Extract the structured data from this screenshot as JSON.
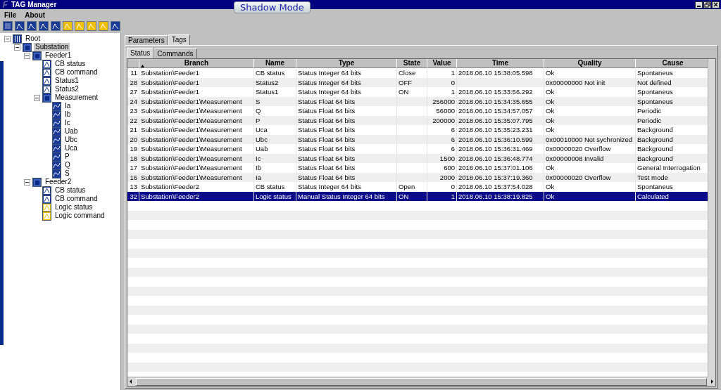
{
  "window": {
    "title": "TAG Manager",
    "mode_button": "Shadow Mode"
  },
  "menu": [
    "File",
    "About"
  ],
  "tree": [
    {
      "label": "Root",
      "kind": "root",
      "expanded": true,
      "selected": false,
      "children": [
        {
          "label": "Substation",
          "kind": "folder",
          "expanded": true,
          "selected": true,
          "children": [
            {
              "label": "Feeder1",
              "kind": "folder",
              "expanded": true,
              "selected": false,
              "children": [
                {
                  "label": "CB status",
                  "kind": "status",
                  "selected": false
                },
                {
                  "label": "CB command",
                  "kind": "command",
                  "selected": false
                },
                {
                  "label": "Status1",
                  "kind": "status",
                  "selected": false
                },
                {
                  "label": "Status2",
                  "kind": "status",
                  "selected": false
                },
                {
                  "label": "Measurement",
                  "kind": "folder",
                  "expanded": true,
                  "selected": false,
                  "children": [
                    {
                      "label": "Ia",
                      "kind": "measure",
                      "selected": false
                    },
                    {
                      "label": "Ib",
                      "kind": "measure",
                      "selected": false
                    },
                    {
                      "label": "Ic",
                      "kind": "measure",
                      "selected": false
                    },
                    {
                      "label": "Uab",
                      "kind": "measure",
                      "selected": false
                    },
                    {
                      "label": "Ubc",
                      "kind": "measure",
                      "selected": false
                    },
                    {
                      "label": "Uca",
                      "kind": "measure",
                      "selected": false
                    },
                    {
                      "label": "P",
                      "kind": "measure",
                      "selected": false
                    },
                    {
                      "label": "Q",
                      "kind": "measure",
                      "selected": false
                    },
                    {
                      "label": "S",
                      "kind": "measure",
                      "selected": false
                    }
                  ]
                }
              ]
            },
            {
              "label": "Feeder2",
              "kind": "folder",
              "expanded": true,
              "selected": false,
              "children": [
                {
                  "label": "CB status",
                  "kind": "status",
                  "selected": false
                },
                {
                  "label": "CB command",
                  "kind": "command",
                  "selected": false
                },
                {
                  "label": "Logic status",
                  "kind": "logic",
                  "selected": false
                },
                {
                  "label": "Logic command",
                  "kind": "logic",
                  "selected": false
                }
              ]
            }
          ]
        }
      ]
    }
  ],
  "tabs": [
    {
      "label": "Parameters",
      "selected": false
    },
    {
      "label": "Tags",
      "selected": true
    }
  ],
  "subtabs": [
    {
      "label": "Status",
      "selected": true
    },
    {
      "label": "Commands",
      "selected": false
    }
  ],
  "table": {
    "columns": [
      "Branch",
      "Name",
      "Type",
      "State",
      "Value",
      "Time",
      "Quality",
      "Cause"
    ],
    "rows": [
      {
        "id": "11",
        "cells": [
          "Substation\\Feeder1",
          "CB status",
          "Status Integer 64 bits",
          "Close",
          "1",
          "2018.06.10 15:38:05.598",
          "Ok",
          "Spontaneus"
        ],
        "selected": false
      },
      {
        "id": "28",
        "cells": [
          "Substation\\Feeder1",
          "Status2",
          "Status Integer 64 bits",
          "OFF",
          "0",
          "",
          "0x00000000 Not init",
          "Not defined"
        ],
        "selected": false
      },
      {
        "id": "27",
        "cells": [
          "Substation\\Feeder1",
          "Status1",
          "Status Integer 64 bits",
          "ON",
          "1",
          "2018.06.10 15:33:56.292",
          "Ok",
          "Spontaneus"
        ],
        "selected": false
      },
      {
        "id": "24",
        "cells": [
          "Substation\\Feeder1\\Measurement",
          "S",
          "Status Float 64 bits",
          "",
          "256000",
          "2018.06.10 15:34:35.655",
          "Ok",
          "Spontaneus"
        ],
        "selected": false
      },
      {
        "id": "23",
        "cells": [
          "Substation\\Feeder1\\Measurement",
          "Q",
          "Status Float 64 bits",
          "",
          "56000",
          "2018.06.10 15:34:57.057",
          "Ok",
          "Periodic"
        ],
        "selected": false
      },
      {
        "id": "22",
        "cells": [
          "Substation\\Feeder1\\Measurement",
          "P",
          "Status Float 64 bits",
          "",
          "200000",
          "2018.06.10 15:35:07.795",
          "Ok",
          "Periodic"
        ],
        "selected": false
      },
      {
        "id": "21",
        "cells": [
          "Substation\\Feeder1\\Measurement",
          "Uca",
          "Status Float 64 bits",
          "",
          "6",
          "2018.06.10 15:35:23.231",
          "Ok",
          "Background"
        ],
        "selected": false
      },
      {
        "id": "20",
        "cells": [
          "Substation\\Feeder1\\Measurement",
          "Ubc",
          "Status Float 64 bits",
          "",
          "6",
          "2018.06.10 15:36:10.599",
          "0x00010000 Not sychronized",
          "Background"
        ],
        "selected": false
      },
      {
        "id": "19",
        "cells": [
          "Substation\\Feeder1\\Measurement",
          "Uab",
          "Status Float 64 bits",
          "",
          "6",
          "2018.06.10 15:36:31.469",
          "0x00000020 Overflow",
          "Background"
        ],
        "selected": false
      },
      {
        "id": "18",
        "cells": [
          "Substation\\Feeder1\\Measurement",
          "Ic",
          "Status Float 64 bits",
          "",
          "1500",
          "2018.06.10 15:36:48.774",
          "0x00000008 Invalid",
          "Background"
        ],
        "selected": false
      },
      {
        "id": "17",
        "cells": [
          "Substation\\Feeder1\\Measurement",
          "Ib",
          "Status Float 64 bits",
          "",
          "600",
          "2018.06.10 15:37:01.106",
          "Ok",
          "General Interrogation"
        ],
        "selected": false
      },
      {
        "id": "16",
        "cells": [
          "Substation\\Feeder1\\Measurement",
          "Ia",
          "Status Float 64 bits",
          "",
          "2000",
          "2018.06.10 15:37:19.360",
          "0x00000020 Overflow",
          "Test mode"
        ],
        "selected": false
      },
      {
        "id": "13",
        "cells": [
          "Substation\\Feeder2",
          "CB status",
          "Status Integer 64 bits",
          "Open",
          "0",
          "2018.06.10 15:37:54.028",
          "Ok",
          "Spontaneus"
        ],
        "selected": false
      },
      {
        "id": "32",
        "cells": [
          "Substation\\Feeder2",
          "Logic status",
          "Manual Status Integer 64 bits",
          "ON",
          "1",
          "2018.06.10 15:38:19.825",
          "Ok",
          "Calculated"
        ],
        "selected": true
      }
    ]
  }
}
